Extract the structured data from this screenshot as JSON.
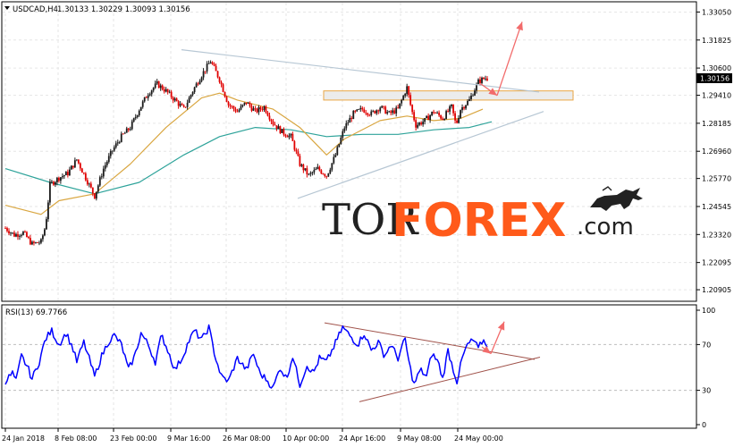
{
  "header": {
    "symbol": "USDCAD,H4",
    "ohlc": "1.30133 1.30229 1.30093 1.30156"
  },
  "logo": {
    "part1": "TOR",
    "part2": "FOREX",
    "part3": ".com"
  },
  "colors": {
    "bull": "#1a1a1a",
    "bear": "#e00000",
    "ma_fast": "#d9a640",
    "ma_slow": "#2ea39a",
    "rsi": "#0000ff",
    "arrow": "#f26b6b",
    "trend": "#b7c7d4",
    "rsi_trend": "#a0524a",
    "zone_fill": "#ececec",
    "zone_edge": "#e8a23a"
  },
  "chart_data": [
    {
      "type": "candlestick",
      "name": "USDCAD,H4",
      "ylim": [
        1.204,
        1.3338
      ],
      "y_ticks": [
        "1.33050",
        "1.31825",
        "1.30600",
        "1.29410",
        "1.28185",
        "1.26960",
        "1.25770",
        "1.24545",
        "1.23320",
        "1.22095",
        "1.20905"
      ],
      "x_ticks": [
        "24 Jan 2018",
        "8 Feb 08:00",
        "23 Feb 00:00",
        "9 Mar 16:00",
        "26 Mar 08:00",
        "10 Apr 00:00",
        "24 Apr 16:00",
        "9 May 08:00",
        "24 May 00:00"
      ],
      "last_price": "1.30156",
      "price_path": [
        [
          0,
          1.236
        ],
        [
          10,
          1.233
        ],
        [
          20,
          1.234
        ],
        [
          30,
          1.229
        ],
        [
          40,
          1.23
        ],
        [
          45,
          1.237
        ],
        [
          50,
          1.255
        ],
        [
          60,
          1.258
        ],
        [
          70,
          1.26
        ],
        [
          80,
          1.266
        ],
        [
          90,
          1.258
        ],
        [
          100,
          1.25
        ],
        [
          110,
          1.262
        ],
        [
          120,
          1.27
        ],
        [
          130,
          1.276
        ],
        [
          140,
          1.28
        ],
        [
          150,
          1.288
        ],
        [
          160,
          1.295
        ],
        [
          170,
          1.299
        ],
        [
          180,
          1.296
        ],
        [
          190,
          1.292
        ],
        [
          200,
          1.288
        ],
        [
          210,
          1.296
        ],
        [
          220,
          1.303
        ],
        [
          230,
          1.309
        ],
        [
          240,
          1.301
        ],
        [
          250,
          1.29
        ],
        [
          260,
          1.287
        ],
        [
          270,
          1.291
        ],
        [
          280,
          1.287
        ],
        [
          290,
          1.289
        ],
        [
          300,
          1.282
        ],
        [
          310,
          1.278
        ],
        [
          320,
          1.276
        ],
        [
          330,
          1.264
        ],
        [
          340,
          1.259
        ],
        [
          350,
          1.262
        ],
        [
          360,
          1.259
        ],
        [
          370,
          1.268
        ],
        [
          380,
          1.28
        ],
        [
          390,
          1.286
        ],
        [
          400,
          1.288
        ],
        [
          410,
          1.286
        ],
        [
          420,
          1.289
        ],
        [
          430,
          1.286
        ],
        [
          440,
          1.288
        ],
        [
          450,
          1.2975
        ],
        [
          455,
          1.288
        ],
        [
          460,
          1.281
        ],
        [
          470,
          1.283
        ],
        [
          480,
          1.287
        ],
        [
          490,
          1.284
        ],
        [
          500,
          1.289
        ],
        [
          505,
          1.281
        ],
        [
          510,
          1.288
        ],
        [
          520,
          1.292
        ],
        [
          530,
          1.3
        ],
        [
          537,
          1.3016
        ]
      ],
      "ma_fast_path": [
        [
          0,
          1.246
        ],
        [
          40,
          1.242
        ],
        [
          60,
          1.248
        ],
        [
          100,
          1.251
        ],
        [
          140,
          1.264
        ],
        [
          180,
          1.28
        ],
        [
          220,
          1.293
        ],
        [
          240,
          1.295
        ],
        [
          260,
          1.292
        ],
        [
          300,
          1.288
        ],
        [
          330,
          1.28
        ],
        [
          360,
          1.268
        ],
        [
          380,
          1.275
        ],
        [
          420,
          1.283
        ],
        [
          450,
          1.285
        ],
        [
          480,
          1.283
        ],
        [
          510,
          1.284
        ],
        [
          535,
          1.288
        ]
      ],
      "ma_slow_path": [
        [
          0,
          1.262
        ],
        [
          50,
          1.256
        ],
        [
          100,
          1.251
        ],
        [
          150,
          1.256
        ],
        [
          200,
          1.268
        ],
        [
          240,
          1.276
        ],
        [
          280,
          1.28
        ],
        [
          320,
          1.279
        ],
        [
          360,
          1.276
        ],
        [
          400,
          1.277
        ],
        [
          440,
          1.277
        ],
        [
          480,
          1.279
        ],
        [
          520,
          1.28
        ],
        [
          545,
          1.2825
        ]
      ],
      "trend_lines": [
        {
          "from": [
            203,
            1.314
          ],
          "to": [
            603,
            1.2955
          ]
        },
        {
          "from": [
            333,
            1.249
          ],
          "to": [
            608,
            1.287
          ]
        }
      ],
      "resistance_zone": [
        362,
        641,
        1.296,
        1.292
      ],
      "arrows": [
        {
          "from": [
            538,
            1.299
          ],
          "to": [
            556,
            1.294
          ]
        },
        {
          "from": [
            556,
            1.294
          ],
          "to": [
            584,
            1.3262
          ]
        }
      ]
    },
    {
      "type": "line",
      "name": "RSI(13)",
      "title": "RSI(13) 69.7766",
      "ylim": [
        0,
        100
      ],
      "y_ticks": [
        100,
        70,
        30,
        0
      ],
      "levels": [
        30,
        70
      ],
      "rsi_path": [
        [
          0,
          38
        ],
        [
          8,
          45
        ],
        [
          12,
          38
        ],
        [
          18,
          60
        ],
        [
          25,
          50
        ],
        [
          30,
          40
        ],
        [
          38,
          55
        ],
        [
          45,
          75
        ],
        [
          52,
          82
        ],
        [
          60,
          70
        ],
        [
          68,
          80
        ],
        [
          75,
          68
        ],
        [
          80,
          55
        ],
        [
          88,
          72
        ],
        [
          95,
          55
        ],
        [
          100,
          42
        ],
        [
          108,
          60
        ],
        [
          115,
          72
        ],
        [
          122,
          78
        ],
        [
          130,
          70
        ],
        [
          138,
          48
        ],
        [
          145,
          60
        ],
        [
          152,
          80
        ],
        [
          160,
          70
        ],
        [
          168,
          55
        ],
        [
          175,
          78
        ],
        [
          182,
          65
        ],
        [
          190,
          48
        ],
        [
          198,
          58
        ],
        [
          205,
          72
        ],
        [
          212,
          82
        ],
        [
          220,
          74
        ],
        [
          228,
          85
        ],
        [
          235,
          60
        ],
        [
          242,
          42
        ],
        [
          250,
          38
        ],
        [
          260,
          58
        ],
        [
          270,
          48
        ],
        [
          278,
          62
        ],
        [
          285,
          45
        ],
        [
          292,
          40
        ],
        [
          300,
          32
        ],
        [
          308,
          50
        ],
        [
          315,
          40
        ],
        [
          322,
          60
        ],
        [
          330,
          35
        ],
        [
          338,
          52
        ],
        [
          345,
          45
        ],
        [
          352,
          58
        ],
        [
          360,
          55
        ],
        [
          368,
          68
        ],
        [
          378,
          85
        ],
        [
          388,
          76
        ],
        [
          395,
          70
        ],
        [
          402,
          80
        ],
        [
          410,
          65
        ],
        [
          418,
          72
        ],
        [
          425,
          60
        ],
        [
          432,
          70
        ],
        [
          440,
          58
        ],
        [
          448,
          75
        ],
        [
          452,
          55
        ],
        [
          458,
          35
        ],
        [
          465,
          48
        ],
        [
          472,
          42
        ],
        [
          478,
          62
        ],
        [
          485,
          55
        ],
        [
          490,
          40
        ],
        [
          496,
          65
        ],
        [
          502,
          48
        ],
        [
          506,
          38
        ],
        [
          512,
          58
        ],
        [
          518,
          70
        ],
        [
          525,
          74
        ],
        [
          530,
          66
        ],
        [
          535,
          74
        ],
        [
          540,
          70
        ]
      ],
      "trend_lines": [
        {
          "from": [
            363,
            89
          ],
          "to": [
            598,
            57
          ]
        },
        {
          "from": [
            402,
            20
          ],
          "to": [
            604,
            59
          ]
        }
      ],
      "arrows": [
        {
          "from": [
            539,
            68
          ],
          "to": [
            549,
            62
          ]
        },
        {
          "from": [
            549,
            62
          ],
          "to": [
            564,
            90
          ]
        }
      ]
    }
  ]
}
